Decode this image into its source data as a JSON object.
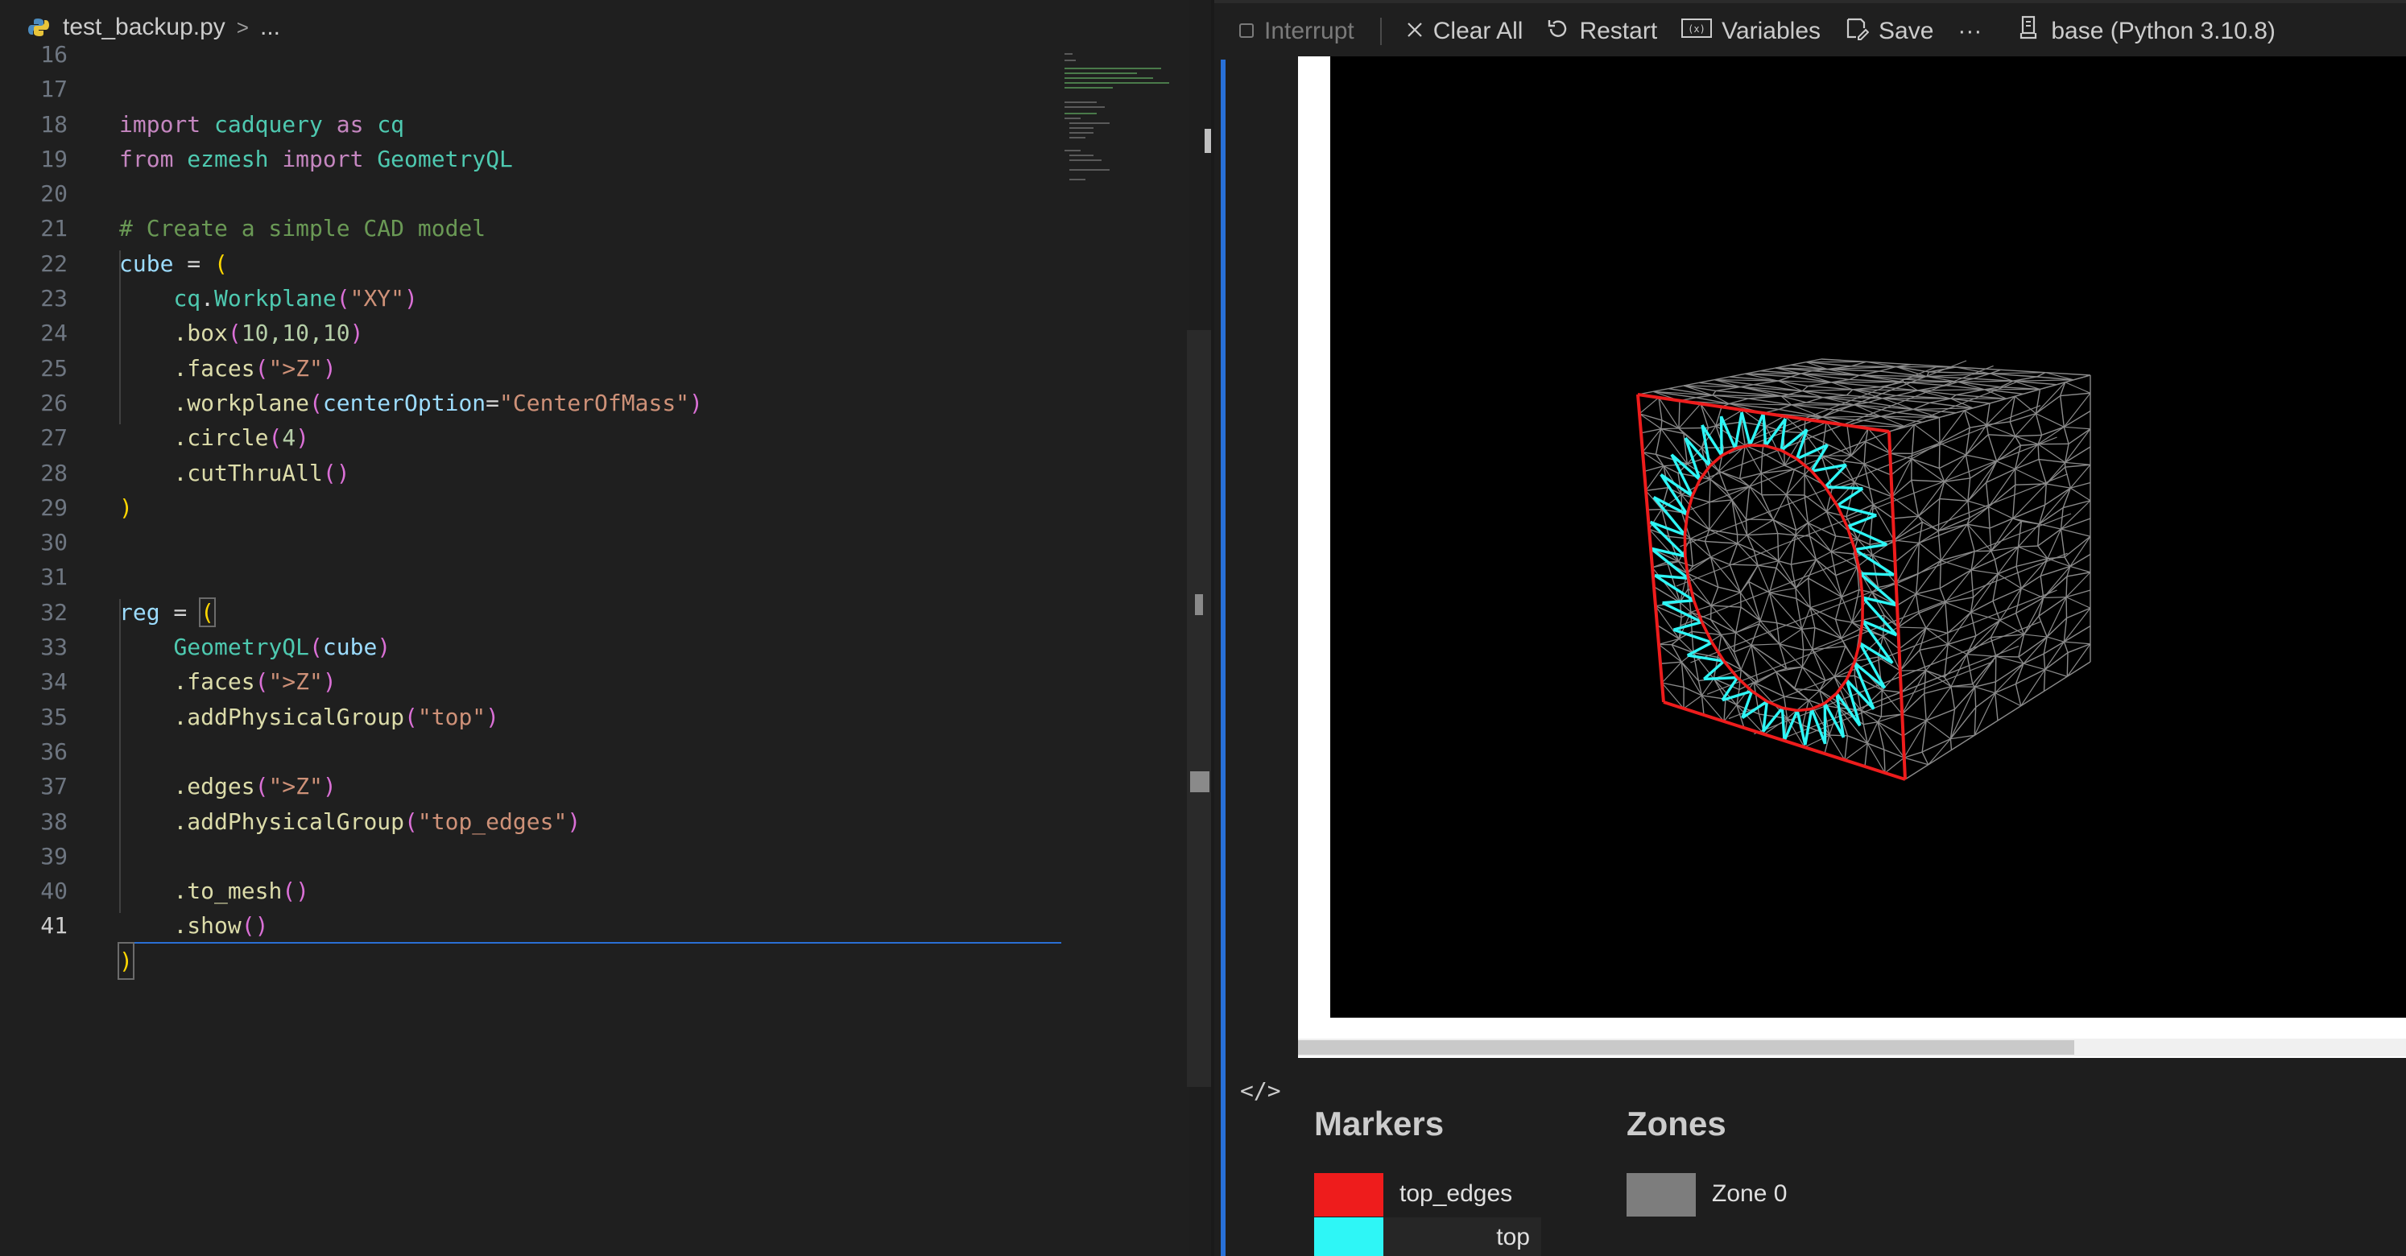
{
  "editor": {
    "breadcrumb": {
      "file": "test_backup.py",
      "separator": ">",
      "rest": "..."
    },
    "line_numbers": [
      "16",
      "17",
      "18",
      "19",
      "20",
      "21",
      "22",
      "23",
      "24",
      "25",
      "26",
      "27",
      "28",
      "29",
      "30",
      "31",
      "32",
      "33",
      "34",
      "35",
      "36",
      "37",
      "38",
      "39",
      "40",
      "41"
    ],
    "active_line": "41",
    "code": {
      "l17_a": "import",
      "l17_b": "cadquery",
      "l17_c": "as",
      "l17_d": "cq",
      "l18_a": "from",
      "l18_b": "ezmesh",
      "l18_c": "import",
      "l18_d": "GeometryQL",
      "l20": "# Create a simple CAD model",
      "l21_a": "cube",
      "l21_b": " = ",
      "l21_c": "(",
      "l22_a": "cq",
      "l22_b": ".",
      "l22_c": "Workplane",
      "l22_d": "(",
      "l22_e": "\"XY\"",
      "l22_f": ")",
      "l23_a": ".box",
      "l23_b": "(",
      "l23_c": "10,10,10",
      "l23_d": ")",
      "l24_a": ".faces",
      "l24_b": "(",
      "l24_c": "\">Z\"",
      "l24_d": ")",
      "l25_a": ".workplane",
      "l25_b": "(",
      "l25_c": "centerOption",
      "l25_d": "=",
      "l25_e": "\"CenterOfMass\"",
      "l25_f": ")",
      "l26_a": ".circle",
      "l26_b": "(",
      "l26_c": "4",
      "l26_d": ")",
      "l27_a": ".cutThruAll",
      "l27_b": "()",
      "l28": ")",
      "l31_a": "reg",
      "l31_b": " = ",
      "l31_c": "(",
      "l32_a": "GeometryQL",
      "l32_b": "(",
      "l32_c": "cube",
      "l32_d": ")",
      "l33_a": ".faces",
      "l33_b": "(",
      "l33_c": "\">Z\"",
      "l33_d": ")",
      "l34_a": ".addPhysicalGroup",
      "l34_b": "(",
      "l34_c": "\"top\"",
      "l34_d": ")",
      "l36_a": ".edges",
      "l36_b": "(",
      "l36_c": "\">Z\"",
      "l36_d": ")",
      "l37_a": ".addPhysicalGroup",
      "l37_b": "(",
      "l37_c": "\"top_edges\"",
      "l37_d": ")",
      "l39_a": ".to_mesh",
      "l39_b": "()",
      "l40_a": ".show",
      "l40_b": "()",
      "l41": ")"
    }
  },
  "toolbar": {
    "interrupt": "Interrupt",
    "clear_all": "Clear All",
    "restart": "Restart",
    "variables": "Variables",
    "save": "Save",
    "more": "···",
    "kernel": "base (Python 3.10.8)"
  },
  "output": {
    "code_toggle": "</>",
    "markers_title": "Markers",
    "zones_title": "Zones",
    "markers": [
      {
        "label": "top_edges",
        "color": "#ee1c1c"
      },
      {
        "label": "top",
        "color": "#2ef6f6"
      }
    ],
    "zones": [
      {
        "label": "Zone 0",
        "color": "#7d7d7d"
      }
    ]
  },
  "colors": {
    "mesh_lines": "#8a8a8a",
    "edge_red": "#ee1c1c",
    "face_cyan": "#2ef6f6",
    "accent_blue": "#2870d8"
  },
  "icons": {
    "breadcrumb": "python-file-icon",
    "interrupt": "stop-square-icon",
    "clear_all": "close-icon",
    "restart": "restart-icon",
    "variables": "variables-icon",
    "save": "save-icon",
    "kernel": "kernel-icon",
    "code_toggle": "code-toggle-icon"
  }
}
